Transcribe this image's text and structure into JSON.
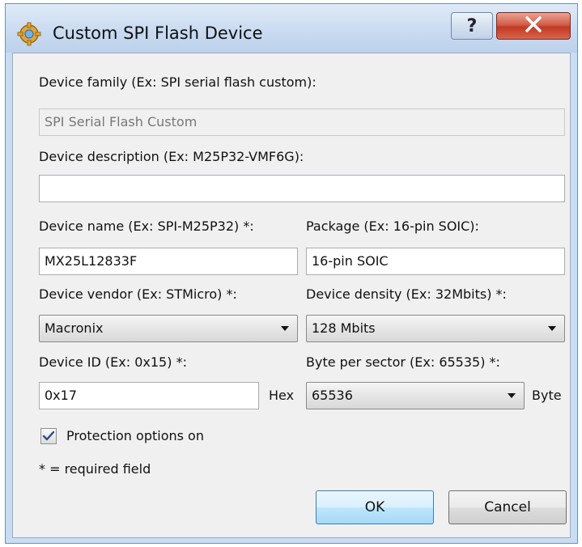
{
  "window": {
    "title": "Custom SPI Flash Device"
  },
  "family": {
    "label": "Device family (Ex: SPI serial flash custom):",
    "value": "SPI Serial Flash Custom"
  },
  "description": {
    "label": "Device description (Ex: M25P32-VMF6G):",
    "value": ""
  },
  "name": {
    "label": "Device name (Ex: SPI-M25P32) *:",
    "value": "MX25L12833F"
  },
  "package": {
    "label": "Package (Ex: 16-pin SOIC):",
    "value": "16-pin SOIC"
  },
  "vendor": {
    "label": "Device vendor (Ex: STMicro) *:",
    "value": "Macronix"
  },
  "density": {
    "label": "Device density (Ex: 32Mbits) *:",
    "value": "128 Mbits"
  },
  "device_id": {
    "label": "Device ID (Ex: 0x15) *:",
    "value": "0x17",
    "suffix": "Hex"
  },
  "sector": {
    "label": "Byte per sector (Ex: 65535) *:",
    "value": "65536",
    "suffix": "Byte"
  },
  "protection": {
    "label": "Protection options on",
    "checked": true
  },
  "required_note": "* = required field",
  "buttons": {
    "ok": "OK",
    "cancel": "Cancel"
  },
  "icons": {
    "app": "gear-chip-icon",
    "help": "help-icon",
    "close": "close-icon"
  }
}
